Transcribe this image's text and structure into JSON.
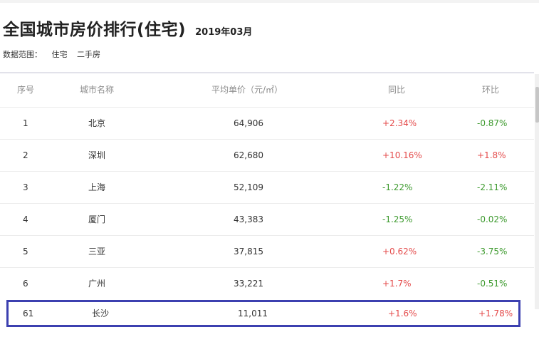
{
  "header": {
    "title": "全国城市房价排行(住宅)",
    "date": "2019年03月"
  },
  "scope": {
    "label": "数据范围：",
    "options": [
      "住宅",
      "二手房"
    ]
  },
  "table": {
    "columns": [
      "序号",
      "城市名称",
      "平均单价（元/㎡）",
      "同比",
      "环比"
    ],
    "rows": [
      {
        "rank": "1",
        "city": "北京",
        "price": "64,906",
        "yoy": "+2.34%",
        "mom": "-0.87%"
      },
      {
        "rank": "2",
        "city": "深圳",
        "price": "62,680",
        "yoy": "+10.16%",
        "mom": "+1.8%"
      },
      {
        "rank": "3",
        "city": "上海",
        "price": "52,109",
        "yoy": "-1.22%",
        "mom": "-2.11%"
      },
      {
        "rank": "4",
        "city": "厦门",
        "price": "43,383",
        "yoy": "-1.25%",
        "mom": "-0.02%"
      },
      {
        "rank": "5",
        "city": "三亚",
        "price": "37,815",
        "yoy": "+0.62%",
        "mom": "-3.75%"
      },
      {
        "rank": "6",
        "city": "广州",
        "price": "33,221",
        "yoy": "+1.7%",
        "mom": "-0.51%"
      }
    ],
    "highlighted": {
      "rank": "61",
      "city": "长沙",
      "price": "11,011",
      "yoy": "+1.6%",
      "mom": "+1.78%"
    }
  },
  "colors": {
    "up": "#e44b4b",
    "down": "#3d9a2e",
    "highlight_border": "#3c40b0"
  }
}
